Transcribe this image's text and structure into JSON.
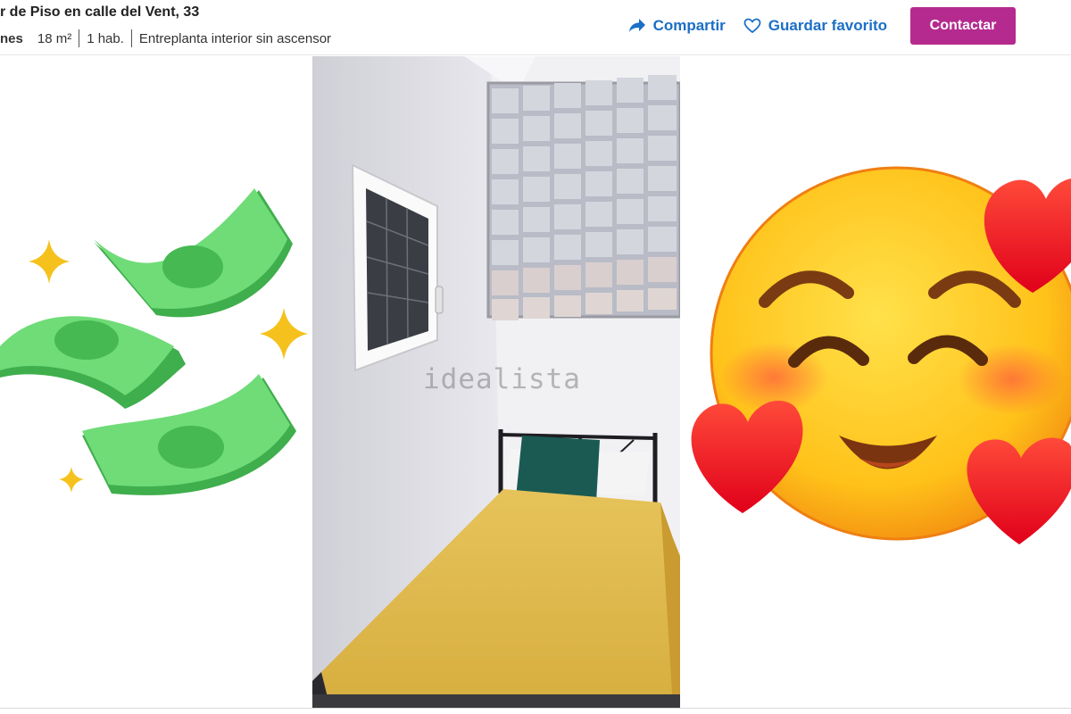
{
  "header": {
    "title": "r de Piso en calle del Vent, 33",
    "price_fragment": "nes",
    "area": "18 m²",
    "rooms": "1 hab.",
    "floor": "Entreplanta interior sin ascensor"
  },
  "actions": {
    "share_label": "Compartir",
    "save_label": "Guardar favorito",
    "contact_label": "Contactar"
  },
  "photo": {
    "watermark": "idealista"
  },
  "icons": {
    "share": "share-arrow-icon",
    "favorite": "heart-outline-icon",
    "money": "flying-money-emoji",
    "smile": "smiling-face-with-hearts-emoji"
  },
  "colors": {
    "link": "#1b6fc6",
    "contact_button": "#b52a8f",
    "money_green": "#5fd46a",
    "sparkle": "#f5c11c",
    "heart": "#ff2a2a",
    "face": "#ffcc1e"
  }
}
